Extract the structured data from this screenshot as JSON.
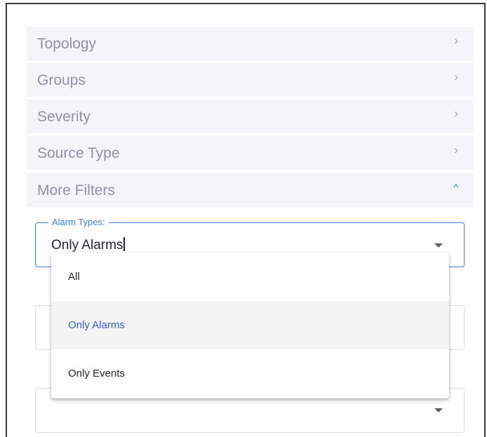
{
  "filters": {
    "sections": [
      {
        "label": "Topology",
        "expanded": false
      },
      {
        "label": "Groups",
        "expanded": false
      },
      {
        "label": "Severity",
        "expanded": false
      },
      {
        "label": "Source Type",
        "expanded": false
      },
      {
        "label": "More Filters",
        "expanded": true
      }
    ],
    "chevron_collapsed": "›",
    "chevron_expanded": "^"
  },
  "alarm_types": {
    "label": "Alarm Types:",
    "value": "Only Alarms",
    "options": [
      "All",
      "Only Alarms",
      "Only Events"
    ],
    "selected_index": 1
  },
  "colors": {
    "accent": "#3b82d8",
    "section_text": "#8f90aa",
    "section_bg": "#f4f5f8",
    "selected_option_text": "#3b5bc6"
  },
  "icons": {
    "collapsed": "chevron-right-icon",
    "expanded": "chevron-up-icon",
    "dropdown": "caret-down-icon"
  }
}
